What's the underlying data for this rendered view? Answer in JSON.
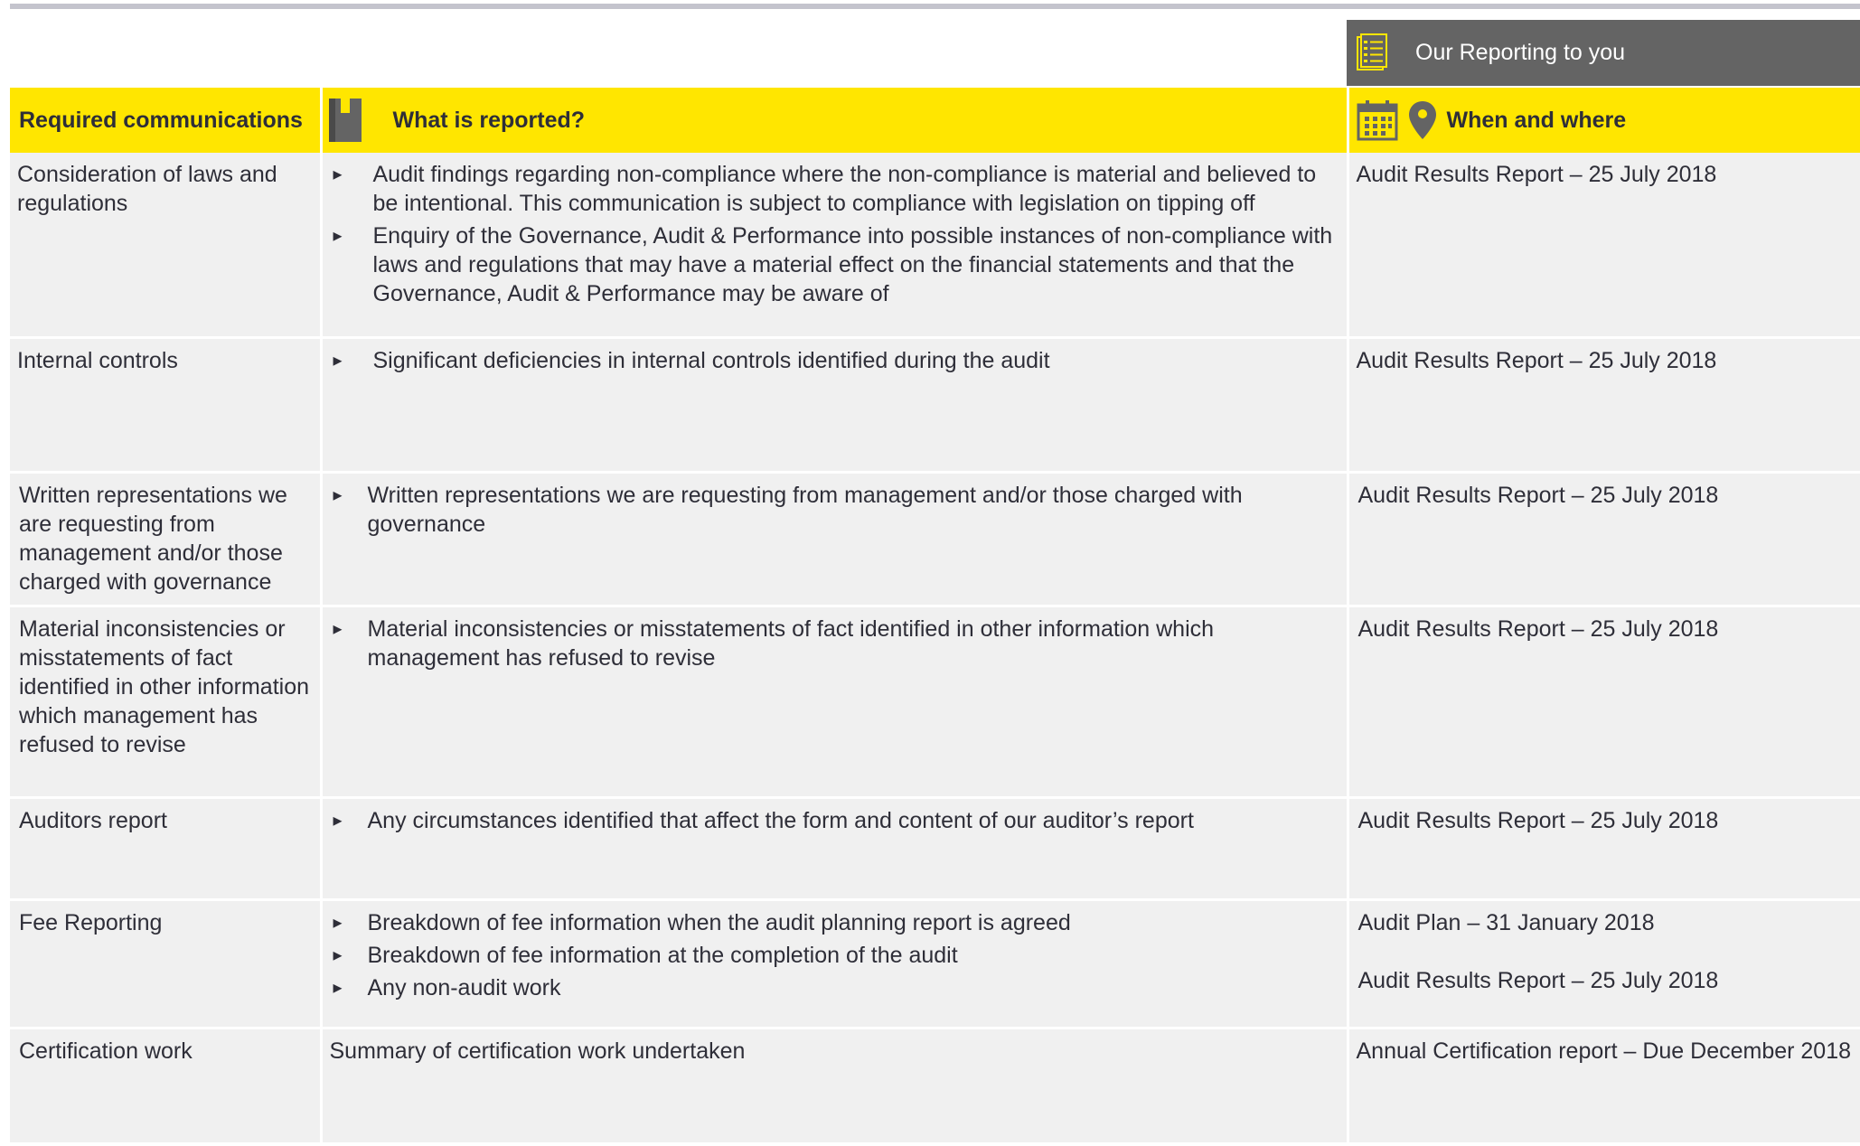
{
  "header": {
    "our_reporting": "Our Reporting to you",
    "col_required": "Required communications",
    "col_what": "What is reported?",
    "col_when": "When and where"
  },
  "icons": {
    "report": "report-checklist-icon",
    "notebook": "notebook-icon",
    "calendar": "calendar-icon",
    "location": "location-pin-icon"
  },
  "colors": {
    "accent": "#ffe600",
    "header_grey": "#646464",
    "row_bg": "#f0f0f0",
    "text": "#2e2e38"
  },
  "rows": [
    {
      "required": "Consideration of laws and regulations",
      "what": [
        "Audit findings regarding non-compliance where the non-compliance is material and believed to be intentional. This communication is subject to compliance with legislation on tipping off",
        "Enquiry of the Governance, Audit  & Performance into possible instances of non-compliance with laws and regulations that may have a material effect on the financial statements and that the Governance, Audit  & Performance may be aware of"
      ],
      "when": [
        "Audit Results Report – 25 July 2018"
      ]
    },
    {
      "required": "Internal controls",
      "what": [
        "Significant deficiencies in internal controls identified during the audit"
      ],
      "when": [
        "Audit Results Report – 25 July 2018"
      ]
    },
    {
      "required": "Written representations we are requesting from management and/or those charged with governance",
      "what": [
        "Written representations we are requesting from management and/or those charged with governance"
      ],
      "when": [
        "Audit Results Report – 25 July 2018"
      ]
    },
    {
      "required": "Material inconsistencies or misstatements of fact identified in other information which management has refused to revise",
      "what": [
        "Material inconsistencies or misstatements of fact identified in other information which management has refused to revise"
      ],
      "when": [
        "Audit Results Report – 25 July 2018"
      ]
    },
    {
      "required": "Auditors report",
      "what": [
        "Any circumstances identified that affect the form and content of our auditor’s report"
      ],
      "when": [
        "Audit Results Report – 25 July 2018"
      ]
    },
    {
      "required": "Fee Reporting",
      "what": [
        "Breakdown of fee information when the  audit planning report is agreed",
        "Breakdown of fee information at the completion of the audit",
        "Any non-audit work"
      ],
      "when": [
        "Audit Plan – 31 January 2018",
        "Audit Results Report – 25 July 2018"
      ]
    },
    {
      "required": "Certification work",
      "what_plain": "Summary of certification work undertaken",
      "when": [
        "Annual Certification report – Due December 2018"
      ]
    }
  ]
}
